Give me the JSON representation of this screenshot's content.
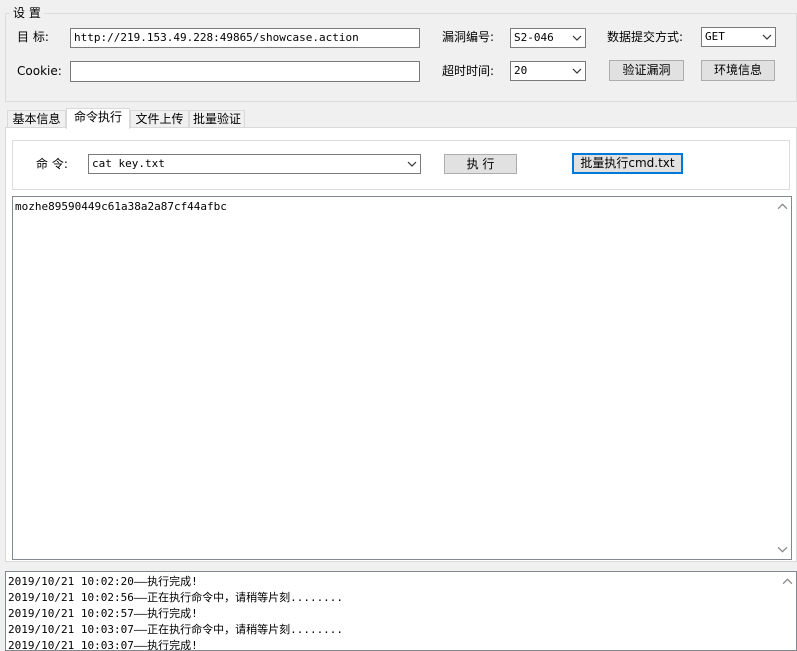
{
  "settings": {
    "legend": "设 置",
    "target_label": "目  标:",
    "target_value": "http://219.153.49.228:49865/showcase.action",
    "cookie_label": "Cookie:",
    "cookie_value": "",
    "vuln_label": "漏洞编号:",
    "vuln_value": "S2-046",
    "timeout_label": "超时时间:",
    "timeout_value": "20",
    "method_label": "数据提交方式:",
    "method_value": "GET",
    "verify_button": "验证漏洞",
    "env_button": "环境信息"
  },
  "tabs": [
    {
      "label": "基本信息"
    },
    {
      "label": "命令执行"
    },
    {
      "label": "文件上传"
    },
    {
      "label": "批量验证"
    }
  ],
  "command": {
    "label": "命 令:",
    "value": "cat key.txt",
    "execute_button": "执 行",
    "batch_button": "批量执行cmd.txt"
  },
  "output": {
    "text": "mozhe89590449c61a38a2a87cf44afbc"
  },
  "log": [
    "2019/10/21 10:02:20——执行完成!",
    "2019/10/21 10:02:56——正在执行命令中，请稍等片刻........",
    "2019/10/21 10:02:57——执行完成!",
    "2019/10/21 10:03:07——正在执行命令中，请稍等片刻........",
    "2019/10/21 10:03:07——执行完成!"
  ],
  "icons": {
    "combo_arrow": "chevron-down-icon",
    "scroll_up": "chevron-up-icon",
    "scroll_down": "chevron-down-icon"
  },
  "colors": {
    "window_bg": "#f0f0f0",
    "accent": "#0078d7",
    "border": "#7a7a7a"
  }
}
